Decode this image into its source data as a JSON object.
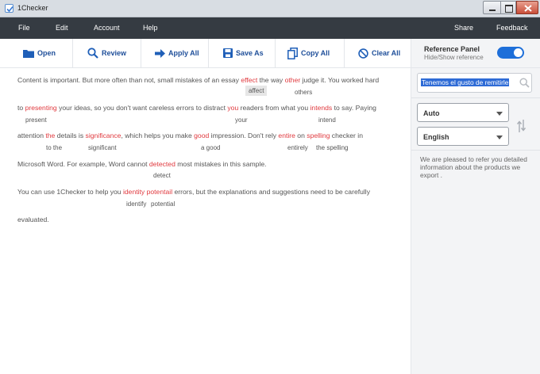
{
  "window": {
    "title": "1Checker"
  },
  "menu": {
    "file": "File",
    "edit": "Edit",
    "account": "Account",
    "help": "Help",
    "share": "Share",
    "feedback": "Feedback"
  },
  "toolbar": {
    "open": "Open",
    "review": "Review",
    "apply_all": "Apply All",
    "save_as": "Save As",
    "copy_all": "Copy All",
    "clear_all": "Clear All"
  },
  "reference_panel": {
    "title": "Reference Panel",
    "subtitle": "Hide/Show reference",
    "toggle_on": true,
    "search_value": "Tenemos el gusto de remitirle",
    "source_language": "Auto",
    "target_language": "English",
    "translation": "We are pleased to refer you detailed information about the products we export ."
  },
  "editor": {
    "lines": [
      {
        "segments": [
          "Content is important. But more often than not, small mistakes of an essay ",
          "effect",
          " the way ",
          "other",
          " judge it. You worked hard"
        ],
        "suggestions": [
          "affect",
          "others"
        ]
      },
      {
        "segments": [
          "to ",
          "presenting",
          " your ideas, so you don't want careless errors to distract ",
          "you",
          " readers from what you ",
          "intends",
          " to say. Paying"
        ],
        "suggestions": [
          "present",
          "your",
          "intend"
        ]
      },
      {
        "segments": [
          "attention ",
          "the",
          " details is ",
          "significance",
          ", which helps you make ",
          "good",
          " impression. Don't rely ",
          "entire",
          " on ",
          "spelling",
          " checker in"
        ],
        "suggestions": [
          "to the",
          "significant",
          "a good",
          "entirely",
          "the spelling"
        ]
      },
      {
        "segments": [
          "Microsoft Word. For example, Word cannot ",
          "detected",
          " most mistakes in this sample."
        ],
        "suggestions": [
          "detect"
        ]
      },
      {
        "segments": [
          "You can use 1Checker to help you ",
          "identity",
          " ",
          "potentail",
          " errors, but the explanations and suggestions need to be carefully"
        ],
        "suggestions": [
          "identify",
          "potential"
        ]
      },
      {
        "segments": [
          "evaluated."
        ],
        "suggestions": []
      }
    ]
  },
  "colors": {
    "error": "#e0393e",
    "accent": "#1e6fd9",
    "menubar": "#353b42"
  }
}
